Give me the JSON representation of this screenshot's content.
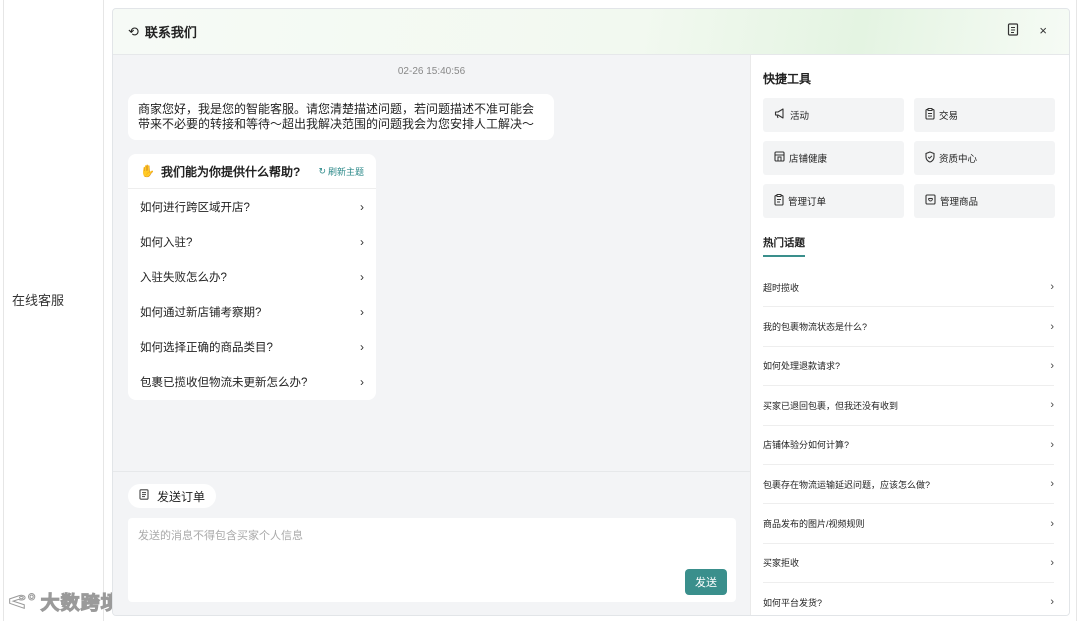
{
  "outer": {
    "left_label": "在线客服",
    "watermark": "大数跨境"
  },
  "header": {
    "title": "联系我们",
    "headset_icon": "headset-icon",
    "notes_icon": "notes-icon",
    "close_symbol": "×"
  },
  "chat": {
    "timestamp": "02-26 15:40:56",
    "greeting": "商家您好，我是您的智能客服。请您清楚描述问题，若问题描述不准可能会带来不必要的转接和等待～超出我解决范围的问题我会为您安排人工解决～",
    "faq": {
      "title": "我们能为你提供什么帮助?",
      "refresh_label": "刷新主题",
      "items": [
        {
          "label": "如何进行跨区域开店?"
        },
        {
          "label": "如何入驻?"
        },
        {
          "label": "入驻失败怎么办?"
        },
        {
          "label": "如何通过新店铺考察期?"
        },
        {
          "label": "如何选择正确的商品类目?"
        },
        {
          "label": "包裹已揽收但物流未更新怎么办?"
        }
      ]
    }
  },
  "composer": {
    "send_order_label": "发送订单",
    "input_value": "",
    "input_placeholder": "发送的消息不得包含买家个人信息",
    "send_label": "发送"
  },
  "sidebar": {
    "quick_tools_title": "快捷工具",
    "tools": [
      {
        "label": "活动",
        "icon": "megaphone-icon",
        "glyph": "📢"
      },
      {
        "label": "交易",
        "icon": "clipboard-icon",
        "glyph": "📋"
      },
      {
        "label": "店铺健康",
        "icon": "store-icon",
        "glyph": "🏪"
      },
      {
        "label": "资质中心",
        "icon": "shield-icon",
        "glyph": "🛡"
      },
      {
        "label": "管理订单",
        "icon": "order-icon",
        "glyph": "📄"
      },
      {
        "label": "管理商品",
        "icon": "box-icon",
        "glyph": "📦"
      }
    ],
    "hot_topics_title": "热门话题",
    "hot_topics": [
      {
        "label": "超时揽收"
      },
      {
        "label": "我的包裹物流状态是什么?"
      },
      {
        "label": "如何处理退款请求?"
      },
      {
        "label": "买家已退回包裹，但我还没有收到"
      },
      {
        "label": "店铺体验分如何计算?"
      },
      {
        "label": "包裹存在物流运输延迟问题，应该怎么做?"
      },
      {
        "label": "商品发布的图片/视频规则"
      },
      {
        "label": "买家拒收"
      },
      {
        "label": "如何平台发货?"
      }
    ]
  },
  "colors": {
    "accent": "#3a8f8c",
    "chat_bg": "#f3f4f6",
    "tool_bg": "#f3f4f5"
  }
}
